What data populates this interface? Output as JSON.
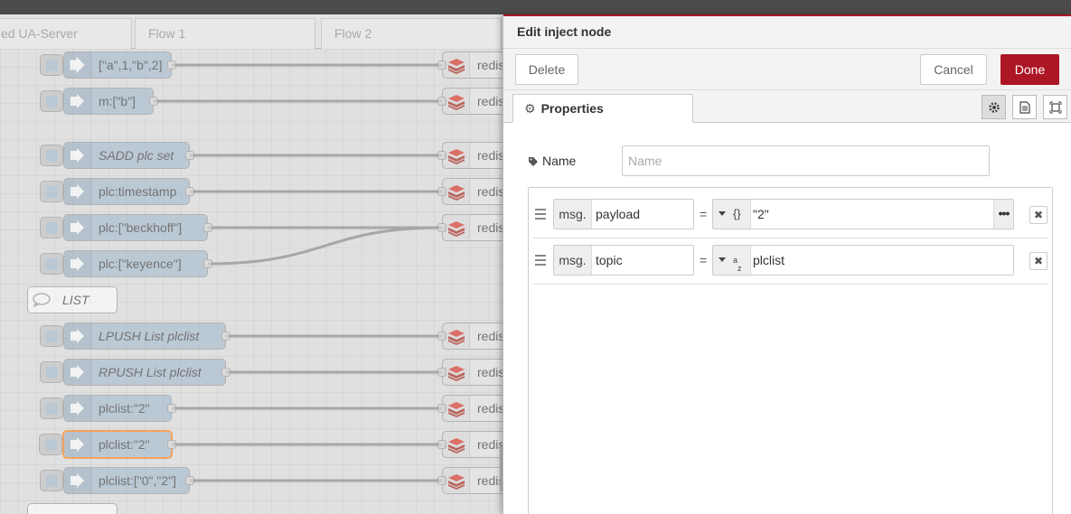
{
  "workspace": {
    "tabs": [
      {
        "label": "ed UA-Server"
      },
      {
        "label": "Flow 1"
      },
      {
        "label": "Flow 2"
      }
    ],
    "inject_nodes": [
      {
        "label": "[\"a\",1,\"b\",2]",
        "italic": false
      },
      {
        "label": "m:[\"b\"]",
        "italic": false
      },
      {
        "label": "SADD plc set",
        "italic": true
      },
      {
        "label": "plc:timestamp",
        "italic": false
      },
      {
        "label": "plc:[\"beckhoff\"]",
        "italic": false
      },
      {
        "label": "plc:[\"keyence\"]",
        "italic": false
      },
      {
        "label": "LPUSH List plclist",
        "italic": true
      },
      {
        "label": "RPUSH List plclist",
        "italic": true
      },
      {
        "label": "plclist:\"2\"",
        "italic": false
      },
      {
        "label": "plclist:\"2\"",
        "italic": false,
        "selected": true
      },
      {
        "label": "plclist:[\"0\",\"2\"]",
        "italic": false
      }
    ],
    "comment": {
      "label": "LIST"
    },
    "redis_label": "redis"
  },
  "tray": {
    "title": "Edit inject node",
    "delete_label": "Delete",
    "cancel_label": "Cancel",
    "done_label": "Done",
    "tab_label": "Properties",
    "name_label": "Name",
    "name_placeholder": "Name",
    "name_value": "",
    "props": [
      {
        "prefix": "msg.",
        "key": "payload",
        "eq": "=",
        "type_label": "{}",
        "value": "\"2\""
      },
      {
        "prefix": "msg.",
        "key": "topic",
        "eq": "=",
        "type_label": "az",
        "value": "plclist"
      }
    ]
  },
  "colors": {
    "accent": "#ad1625",
    "inject_node": "#a6bbcf",
    "selected_outline": "#ff7f0e"
  }
}
